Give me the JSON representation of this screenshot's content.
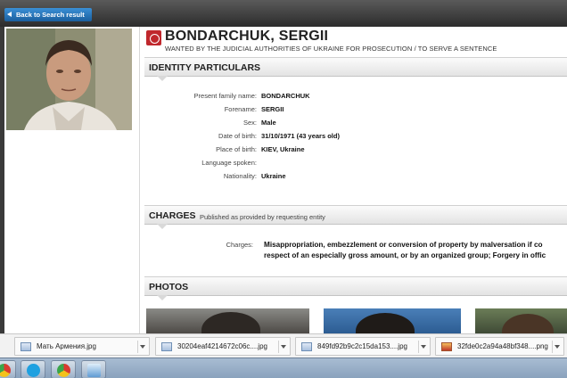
{
  "header": {
    "back_label": "Back to Search result"
  },
  "person": {
    "name": "BONDARCHUK, SERGII",
    "wanted_line": "WANTED BY THE JUDICIAL AUTHORITIES OF UKRAINE FOR PROSECUTION / TO SERVE A SENTENCE"
  },
  "identity": {
    "title": "IDENTITY PARTICULARS",
    "rows": [
      {
        "label": "Present family name:",
        "value": "BONDARCHUK"
      },
      {
        "label": "Forename:",
        "value": "SERGII"
      },
      {
        "label": "Sex:",
        "value": "Male"
      },
      {
        "label": "Date of birth:",
        "value": "31/10/1971 (43 years old)"
      },
      {
        "label": "Place of birth:",
        "value": "KIEV, Ukraine"
      },
      {
        "label": "Language spoken:",
        "value": ""
      },
      {
        "label": "Nationality:",
        "value": "Ukraine"
      }
    ]
  },
  "charges": {
    "title": "CHARGES",
    "subtitle": "Published as provided by requesting entity",
    "label": "Charges:",
    "line1": "Misappropriation, embezzlement or conversion of property by malversation if co",
    "line2": "respect of an especially gross amount, or by an organized group; Forgery in offic"
  },
  "photos": {
    "title": "PHOTOS"
  },
  "downloads": [
    {
      "name": "Мать Армения.jpg",
      "icon": "image-file-icon"
    },
    {
      "name": "30204eaf4214672c06c....jpg",
      "icon": "image-file-icon"
    },
    {
      "name": "849fd92b9c2c15da153....jpg",
      "icon": "image-file-icon"
    },
    {
      "name": "32fde0c2a94a48bf348....png",
      "icon": "png-file-icon"
    }
  ],
  "taskbar": [
    {
      "icon": "chrome-icon",
      "color": "#e0a21c"
    },
    {
      "icon": "skype-icon",
      "color": "#1ea0e0"
    },
    {
      "icon": "chrome-icon",
      "color": "#d9442f"
    },
    {
      "icon": "notepad-icon",
      "color": "#5f9bd3"
    }
  ]
}
